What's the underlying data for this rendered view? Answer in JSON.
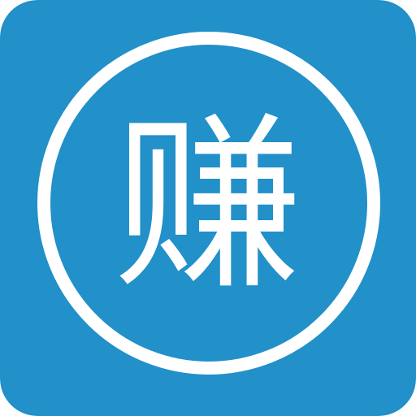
{
  "app_icon": {
    "glyph": "赚",
    "background_color": "#2290c9",
    "ring_color": "#ffffff",
    "glyph_color": "#ffffff",
    "icon_name": "earn-character-icon"
  }
}
